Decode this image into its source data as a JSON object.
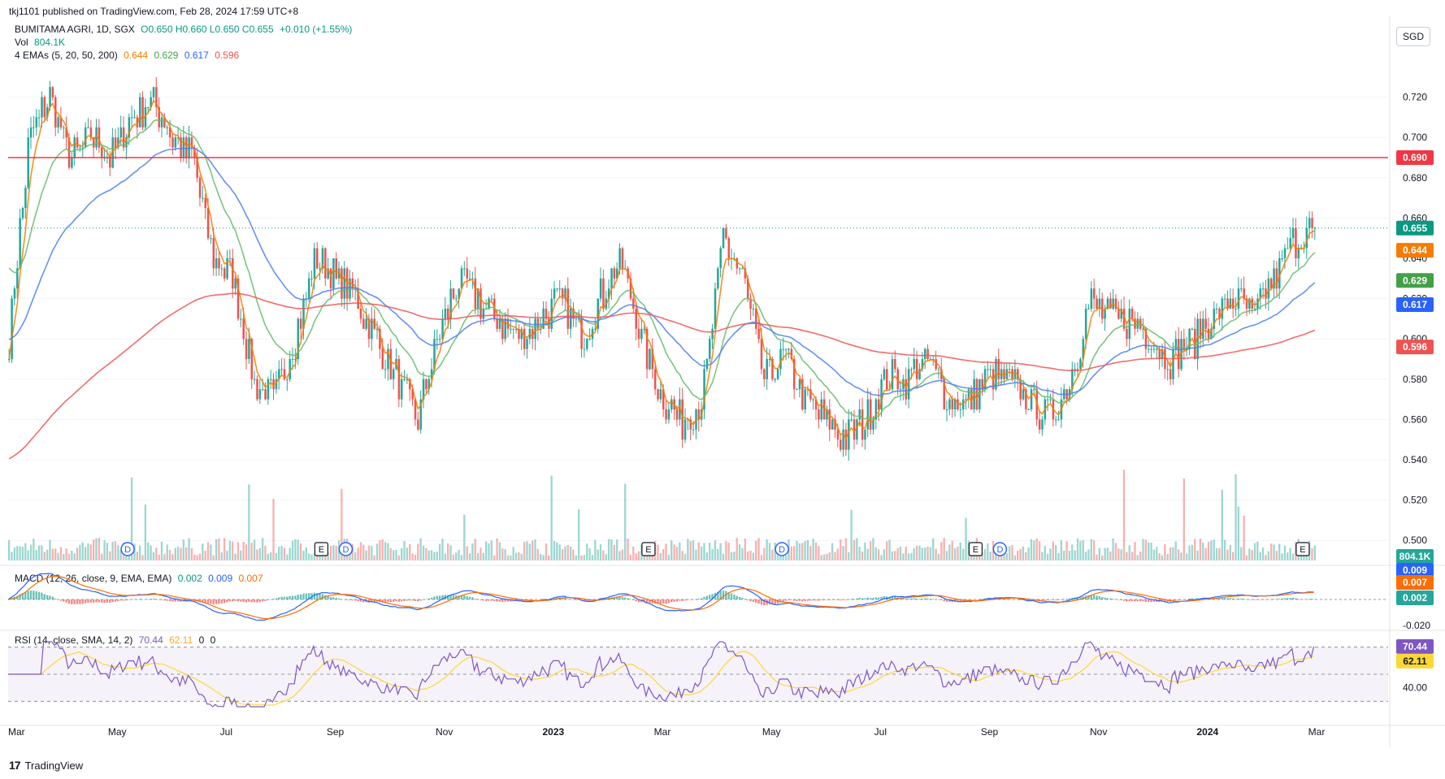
{
  "header": {
    "publish_line": "tkj1101 published on TradingView.com, Feb 28, 2024 17:59 UTC+8"
  },
  "legend": {
    "symbol": "BUMITAMA AGRI, 1D, SGX",
    "ohlc": "O0.650  H0.660  L0.650  C0.655",
    "change": "+0.010 (+1.55%)",
    "volume_label": "Vol",
    "volume_value": "804.1K",
    "ema_label": "4 EMAs (5, 20, 50, 200)",
    "ema_values": [
      "0.644",
      "0.629",
      "0.617",
      "0.596"
    ],
    "macd_label": "MACD (12, 26, close, 9, EMA, EMA)",
    "macd_values": [
      "0.002",
      "0.009",
      "0.007"
    ],
    "rsi_label": "RSI (14, close, SMA, 14, 2)",
    "rsi_values": [
      "70.44",
      "62.11",
      "0",
      "0"
    ]
  },
  "toolbar": {
    "currency": "SGD"
  },
  "footer": {
    "brand": "TradingView"
  },
  "colors": {
    "up": "#26a69a",
    "down": "#ef5350",
    "ema5": "#f57c00",
    "ema20": "#66bb6a",
    "ema50": "#4c7ff0",
    "ema200": "#ef5350",
    "macd": "#2962ff",
    "signal": "#ff6d00",
    "rsi": "#7e57c2",
    "rsi_ma": "#fdd835",
    "hline": "#f23645"
  },
  "chart_data": {
    "type": "candlestick",
    "x_ticks": [
      "Mar",
      "May",
      "Jul",
      "Sep",
      "Nov",
      "2023",
      "Mar",
      "May",
      "Jul",
      "Sep",
      "Nov",
      "2024",
      "Mar"
    ],
    "y_ticks": [
      "0.720",
      "0.700",
      "0.680",
      "0.660",
      "0.640",
      "0.620",
      "0.600",
      "0.580",
      "0.560",
      "0.540",
      "0.520",
      "0.500"
    ],
    "ylim": [
      0.49,
      0.74
    ],
    "horizontal_line": 0.69,
    "last_close": 0.655,
    "price_tags": [
      {
        "value": 0.69,
        "text": "0.690",
        "color": "#f23645"
      },
      {
        "value": 0.655,
        "text": "0.655",
        "color": "#089981"
      },
      {
        "value": 0.644,
        "text": "0.644",
        "color": "#f57c00"
      },
      {
        "value": 0.629,
        "text": "0.629",
        "color": "#43a047"
      },
      {
        "value": 0.617,
        "text": "0.617",
        "color": "#2962ff"
      },
      {
        "value": 0.596,
        "text": "0.596",
        "color": "#ef5350"
      }
    ],
    "volume_tag": "804.1K",
    "price_anchors": [
      0.6,
      0.7,
      0.72,
      0.69,
      0.7,
      0.69,
      0.71,
      0.72,
      0.7,
      0.69,
      0.64,
      0.63,
      0.58,
      0.57,
      0.6,
      0.64,
      0.63,
      0.62,
      0.6,
      0.58,
      0.56,
      0.6,
      0.63,
      0.62,
      0.61,
      0.6,
      0.61,
      0.62,
      0.6,
      0.62,
      0.64,
      0.6,
      0.57,
      0.56,
      0.57,
      0.65,
      0.63,
      0.58,
      0.59,
      0.57,
      0.56,
      0.55,
      0.56,
      0.58,
      0.58,
      0.59,
      0.57,
      0.57,
      0.58,
      0.58,
      0.57,
      0.56,
      0.58,
      0.62,
      0.61,
      0.61,
      0.6,
      0.59,
      0.6,
      0.61,
      0.62,
      0.61,
      0.63,
      0.65,
      0.655
    ],
    "ema_start": {
      "ema20": 0.64,
      "ema50": 0.6,
      "ema200": 0.54
    },
    "events": [
      {
        "type": "D",
        "month": "Apr 2022"
      },
      {
        "type": "E",
        "month": "Aug 2022"
      },
      {
        "type": "D",
        "month": "Aug 2022"
      },
      {
        "type": "E",
        "month": "Feb 2023"
      },
      {
        "type": "D",
        "month": "Apr 2023"
      },
      {
        "type": "E",
        "month": "Aug 2023"
      },
      {
        "type": "D",
        "month": "Aug 2023"
      },
      {
        "type": "E",
        "month": "Feb 2024"
      }
    ],
    "macd_axis": {
      "ticks": [
        "0.009",
        "0.007",
        "0.002",
        "-0.020"
      ],
      "tag_values": [
        "0.009",
        "0.007",
        "0.002"
      ]
    },
    "rsi_axis": {
      "ticks": [
        "40.00"
      ],
      "tag_values": [
        "70.44",
        "62.11"
      ],
      "bands": [
        70,
        30
      ]
    }
  }
}
